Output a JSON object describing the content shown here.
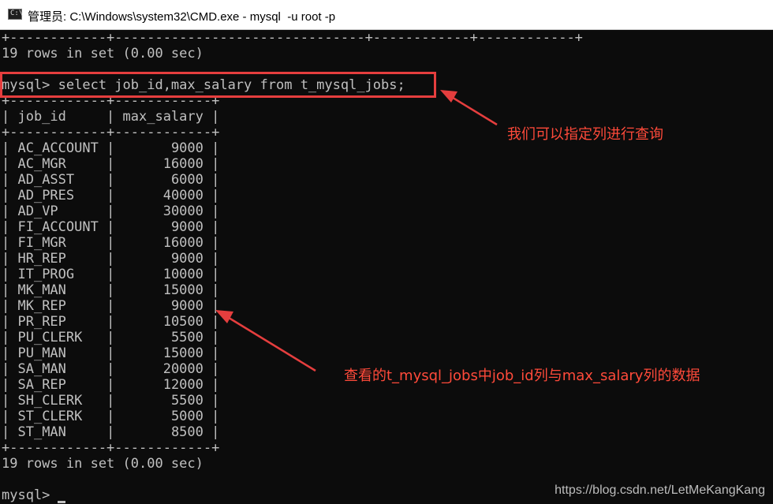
{
  "window": {
    "title": "管理员: C:\\Windows\\system32\\CMD.exe - mysql  -u root -p",
    "icon": "cmd-icon",
    "icon_label": "C:\\"
  },
  "console": {
    "top_border": "+------------+-------------------------------+------------+------------+",
    "prev_result": "19 rows in set (0.00 sec)",
    "command_line": "mysql> select job_id,max_salary from t_mysql_jobs;",
    "table_border": "+------------+------------+",
    "header_row": "| job_id     | max_salary |",
    "rows": [
      {
        "job_id": "AC_ACCOUNT",
        "max_salary": "9000"
      },
      {
        "job_id": "AC_MGR",
        "max_salary": "16000"
      },
      {
        "job_id": "AD_ASST",
        "max_salary": "6000"
      },
      {
        "job_id": "AD_PRES",
        "max_salary": "40000"
      },
      {
        "job_id": "AD_VP",
        "max_salary": "30000"
      },
      {
        "job_id": "FI_ACCOUNT",
        "max_salary": "9000"
      },
      {
        "job_id": "FI_MGR",
        "max_salary": "16000"
      },
      {
        "job_id": "HR_REP",
        "max_salary": "9000"
      },
      {
        "job_id": "IT_PROG",
        "max_salary": "10000"
      },
      {
        "job_id": "MK_MAN",
        "max_salary": "15000"
      },
      {
        "job_id": "MK_REP",
        "max_salary": "9000"
      },
      {
        "job_id": "PR_REP",
        "max_salary": "10500"
      },
      {
        "job_id": "PU_CLERK",
        "max_salary": "5500"
      },
      {
        "job_id": "PU_MAN",
        "max_salary": "15000"
      },
      {
        "job_id": "SA_MAN",
        "max_salary": "20000"
      },
      {
        "job_id": "SA_REP",
        "max_salary": "12000"
      },
      {
        "job_id": "SH_CLERK",
        "max_salary": "5500"
      },
      {
        "job_id": "ST_CLERK",
        "max_salary": "5000"
      },
      {
        "job_id": "ST_MAN",
        "max_salary": "8500"
      }
    ],
    "result": "19 rows in set (0.00 sec)",
    "prompt": "mysql>"
  },
  "annotations": {
    "note1": "我们可以指定列进行查询",
    "note2": "查看的t_mysql_jobs中job_id列与max_salary列的数据",
    "color": "#e53e3e"
  },
  "watermark": "https://blog.csdn.net/LetMeKangKang"
}
